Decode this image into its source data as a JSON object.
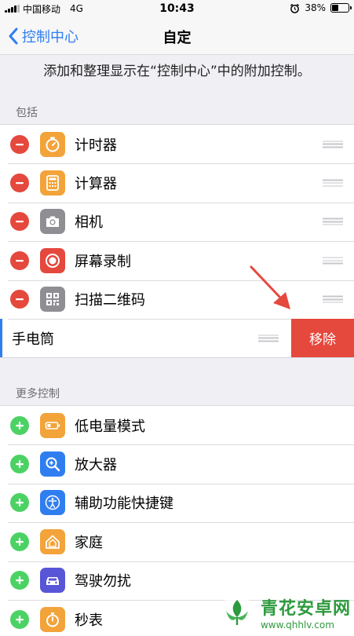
{
  "status_bar": {
    "carrier": "中国移动",
    "network": "4G",
    "time": "10:43",
    "battery": "38%",
    "battery_level": 0.38,
    "icons": [
      "signal-icon",
      "alarm-icon",
      "battery-icon"
    ]
  },
  "nav": {
    "back_label": "控制中心",
    "title": "自定"
  },
  "description": "添加和整理显示在“控制中心”中的附加控制。",
  "sections": {
    "included": {
      "header": "包括",
      "items": [
        {
          "label": "计时器",
          "icon": "timer-icon",
          "color": "#f2a33a"
        },
        {
          "label": "计算器",
          "icon": "calculator-icon",
          "color": "#f2a33a"
        },
        {
          "label": "相机",
          "icon": "camera-icon",
          "color": "#8e8e93"
        },
        {
          "label": "屏幕录制",
          "icon": "screen-record-icon",
          "color": "#e5483d"
        },
        {
          "label": "扫描二维码",
          "icon": "qr-code-icon",
          "color": "#8e8e93"
        }
      ],
      "swiped_item": {
        "label": "手电筒",
        "action": "移除"
      }
    },
    "more": {
      "header": "更多控制",
      "items": [
        {
          "label": "低电量模式",
          "icon": "low-power-icon",
          "color": "#f2a33a"
        },
        {
          "label": "放大器",
          "icon": "magnifier-icon",
          "color": "#2f7ef0"
        },
        {
          "label": "辅助功能快捷键",
          "icon": "accessibility-icon",
          "color": "#2f7ef0"
        },
        {
          "label": "家庭",
          "icon": "home-icon",
          "color": "#f2a33a"
        },
        {
          "label": "驾驶勿扰",
          "icon": "car-icon",
          "color": "#5856d6"
        },
        {
          "label": "秒表",
          "icon": "stopwatch-icon",
          "color": "#f2a33a"
        }
      ]
    }
  },
  "colors": {
    "accent": "#2f7ef0",
    "remove": "#e5483d",
    "add": "#4cd264",
    "watermark": "#2e9a3e"
  },
  "watermark": {
    "title": "青花安卓网",
    "url": "www.qhhlv.com"
  }
}
